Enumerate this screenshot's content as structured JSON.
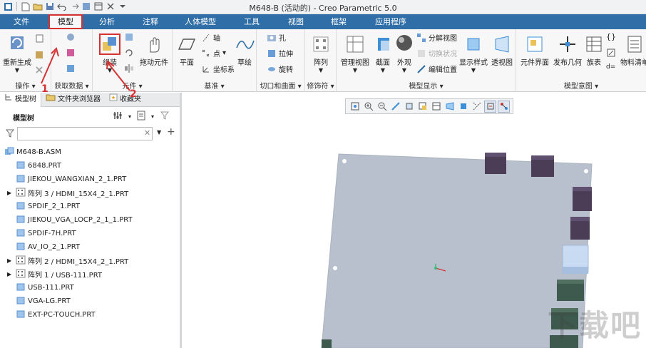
{
  "window": {
    "title": "M648-B (活动的) - Creo Parametric 5.0"
  },
  "tabs": [
    {
      "label": "文件"
    },
    {
      "label": "模型"
    },
    {
      "label": "分析"
    },
    {
      "label": "注释"
    },
    {
      "label": "人体模型"
    },
    {
      "label": "工具"
    },
    {
      "label": "视图"
    },
    {
      "label": "框架"
    },
    {
      "label": "应用程序"
    }
  ],
  "ribbon": {
    "ops": {
      "regen": "重新生成",
      "label": "操作"
    },
    "getdata": {
      "label": "获取数据"
    },
    "component": {
      "assemble": "组装",
      "drag": "拖动元件",
      "label": "元件"
    },
    "datum": {
      "plane": "平面",
      "axis": "轴",
      "point": "点",
      "csys": "坐标系",
      "sketch": "草绘",
      "label": "基准"
    },
    "cut": {
      "hole": "孔",
      "extrude": "拉伸",
      "revolve": "旋转",
      "label": "切口和曲面"
    },
    "modifier": {
      "pattern": "阵列",
      "label": "修饰符"
    },
    "display": {
      "manage": "管理视图",
      "section": "截面",
      "appearance": "外观",
      "explode": "分解视图",
      "toggle": "切换状况",
      "edit": "编辑位置",
      "style": "显示样式",
      "perspective": "透视图",
      "label": "模型显示"
    },
    "intent": {
      "interface": "元件界面",
      "publish": "发布几何",
      "table": "族表",
      "bom": "物料清单",
      "label": "模型意图"
    },
    "annotations": {
      "n1": "1",
      "n2": "2"
    }
  },
  "nav": {
    "tabs": [
      {
        "label": "模型树"
      },
      {
        "label": "文件夹浏览器"
      },
      {
        "label": "收藏夹"
      }
    ],
    "tree_title": "模型树",
    "filter_placeholder": "",
    "items": [
      {
        "label": "M648-B.ASM"
      },
      {
        "label": "6848.PRT"
      },
      {
        "label": "JIEKOU_WANGXIAN_2_1.PRT"
      },
      {
        "label": "阵列 3 / HDMI_15X4_2_1.PRT"
      },
      {
        "label": "SPDIF_2_1.PRT"
      },
      {
        "label": "JIEKOU_VGA_LOCP_2_1_1.PRT"
      },
      {
        "label": "SPDIF-7H.PRT"
      },
      {
        "label": "AV_IO_2_1.PRT"
      },
      {
        "label": "阵列 2 / HDMI_15X4_2_1.PRT"
      },
      {
        "label": "阵列 1 / USB-111.PRT"
      },
      {
        "label": "USB-111.PRT"
      },
      {
        "label": "VGA-LG.PRT"
      },
      {
        "label": "EXT-PC-TOUCH.PRT"
      }
    ]
  },
  "watermark": "下载吧",
  "colors": {
    "tabbar": "#2f6ea6",
    "highlight": "#d63232",
    "board": "#b7c0cc",
    "purple": "#4a3d55",
    "green": "#3e5a4e",
    "lightblue": "#c9dbf2"
  }
}
